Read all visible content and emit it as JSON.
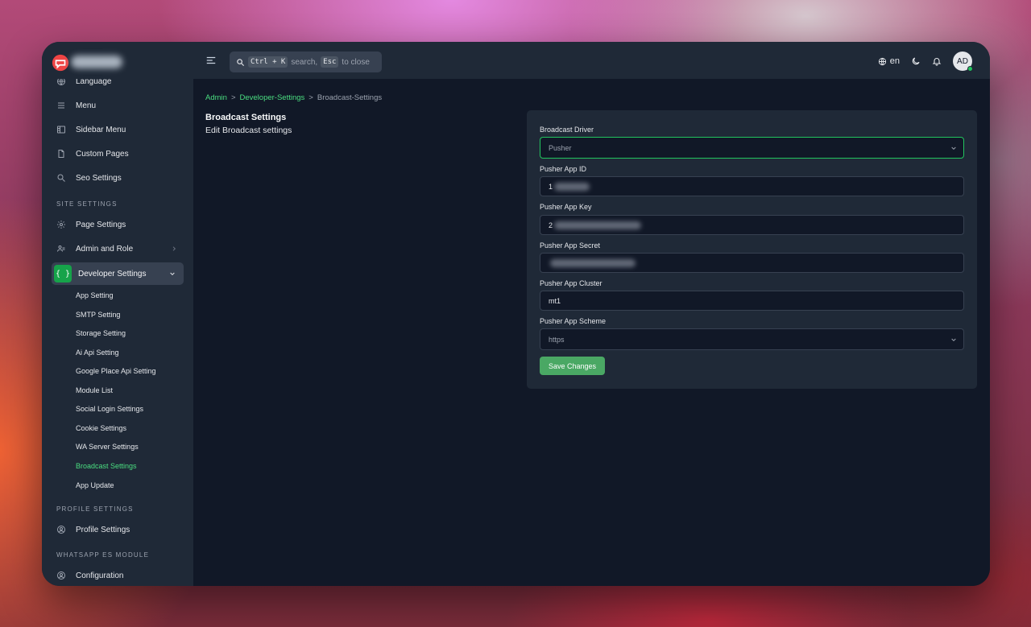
{
  "topbar": {
    "search_kbd_open": "Ctrl + K",
    "search_text_mid": "search,",
    "search_kbd_close": "Esc",
    "search_text_end": "to close",
    "language": "en",
    "avatar_initials": "AD"
  },
  "sidebar": {
    "items_top": [
      {
        "label": "Language",
        "icon": "globe-icon"
      },
      {
        "label": "Menu",
        "icon": "menu-icon"
      },
      {
        "label": "Sidebar Menu",
        "icon": "layout-icon"
      },
      {
        "label": "Custom Pages",
        "icon": "file-icon"
      },
      {
        "label": "Seo Settings",
        "icon": "search-icon"
      }
    ],
    "section_site": "SITE SETTINGS",
    "items_site": [
      {
        "label": "Page Settings",
        "icon": "gear-icon"
      },
      {
        "label": "Admin and Role",
        "icon": "users-icon"
      }
    ],
    "developer": {
      "label": "Developer Settings",
      "icon": "braces-icon",
      "glyph": "{ }"
    },
    "developer_sub": [
      "App Setting",
      "SMTP Setting",
      "Storage Setting",
      "Ai Api Setting",
      "Google Place Api Setting",
      "Module List",
      "Social Login Settings",
      "Cookie Settings",
      "WA Server Settings",
      "Broadcast Settings",
      "App Update"
    ],
    "active_sub": "Broadcast Settings",
    "section_profile": "PROFILE SETTINGS",
    "profile_item": {
      "label": "Profile Settings",
      "icon": "user-circle-icon"
    },
    "section_whatsapp": "WHATSAPP ES MODULE",
    "config_item": {
      "label": "Configuration",
      "icon": "user-circle-icon"
    }
  },
  "breadcrumb": {
    "items": [
      "Admin",
      "Developer-Settings",
      "Broadcast-Settings"
    ],
    "separator": ">"
  },
  "page": {
    "title": "Broadcast Settings",
    "subtitle": "Edit Broadcast settings"
  },
  "form": {
    "broadcast_driver": {
      "label": "Broadcast Driver",
      "value": "Pusher"
    },
    "app_id": {
      "label": "Pusher App ID",
      "value": "1"
    },
    "app_key": {
      "label": "Pusher App Key",
      "value": "2"
    },
    "app_secret": {
      "label": "Pusher App Secret",
      "value": ""
    },
    "app_cluster": {
      "label": "Pusher App Cluster",
      "value": "mt1"
    },
    "app_scheme": {
      "label": "Pusher App Scheme",
      "value": "https"
    },
    "save_label": "Save Changes"
  },
  "colors": {
    "accent": "#4ade80",
    "button": "#4aa864",
    "sidebar_bg": "#1f2937",
    "main_bg": "#111827"
  }
}
